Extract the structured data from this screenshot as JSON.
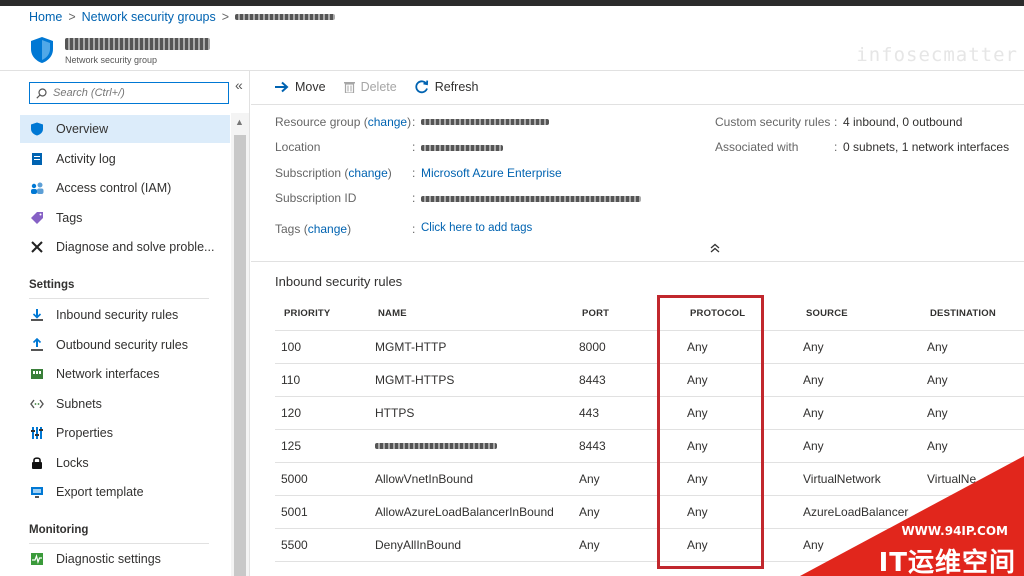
{
  "breadcrumb": {
    "home": "Home",
    "parent": "Network security groups",
    "sep": ">"
  },
  "resource": {
    "type_label": "Network security group"
  },
  "watermark": "infosecmatter",
  "sidebar": {
    "search_placeholder": "Search (Ctrl+/)",
    "collapse": "«",
    "items_top": [
      {
        "label": "Overview",
        "icon": "shield-icon"
      },
      {
        "label": "Activity log",
        "icon": "activity-log-icon"
      },
      {
        "label": "Access control (IAM)",
        "icon": "people-icon"
      },
      {
        "label": "Tags",
        "icon": "tag-icon"
      },
      {
        "label": "Diagnose and solve proble...",
        "icon": "wrench-icon"
      }
    ],
    "settings_title": "Settings",
    "items_settings": [
      {
        "label": "Inbound security rules",
        "icon": "inbound-icon"
      },
      {
        "label": "Outbound security rules",
        "icon": "outbound-icon"
      },
      {
        "label": "Network interfaces",
        "icon": "network-interface-icon"
      },
      {
        "label": "Subnets",
        "icon": "subnet-icon"
      },
      {
        "label": "Properties",
        "icon": "properties-icon"
      },
      {
        "label": "Locks",
        "icon": "lock-icon"
      },
      {
        "label": "Export template",
        "icon": "export-icon"
      }
    ],
    "monitoring_title": "Monitoring",
    "items_monitoring": [
      {
        "label": "Diagnostic settings",
        "icon": "diagnostic-icon"
      }
    ]
  },
  "toolbar": {
    "move": "Move",
    "delete": "Delete",
    "refresh": "Refresh"
  },
  "essentials": {
    "resource_group_label": "Resource group",
    "change": "change",
    "location_label": "Location",
    "subscription_label": "Subscription",
    "subscription_value": "Microsoft Azure Enterprise",
    "subscription_id_label": "Subscription ID",
    "tags_label": "Tags",
    "tags_value": "Click here to add tags",
    "custom_rules_label": "Custom security rules",
    "custom_rules_value": "4 inbound, 0 outbound",
    "associated_label": "Associated with",
    "associated_value": "0 subnets, 1 network interfaces",
    "colon": ":"
  },
  "rules": {
    "title": "Inbound security rules",
    "columns": [
      "PRIORITY",
      "NAME",
      "PORT",
      "PROTOCOL",
      "SOURCE",
      "DESTINATION"
    ],
    "rows": [
      [
        "100",
        "MGMT-HTTP",
        "8000",
        "Any",
        "Any",
        "Any"
      ],
      [
        "110",
        "MGMT-HTTPS",
        "8443",
        "Any",
        "Any",
        "Any"
      ],
      [
        "120",
        "HTTPS",
        "443",
        "Any",
        "Any",
        "Any"
      ],
      [
        "125",
        "",
        "8443",
        "Any",
        "Any",
        "Any"
      ],
      [
        "5000",
        "AllowVnetInBound",
        "Any",
        "Any",
        "VirtualNetwork",
        "VirtualNe"
      ],
      [
        "5001",
        "AllowAzureLoadBalancerInBound",
        "Any",
        "Any",
        "AzureLoadBalancer",
        ""
      ],
      [
        "5500",
        "DenyAllInBound",
        "Any",
        "Any",
        "Any",
        ""
      ]
    ]
  },
  "corner": {
    "url": "WWW.94IP.COM",
    "brand": "IT运维空间"
  },
  "colors": {
    "accent": "#0078d4",
    "link": "#0063b1",
    "highlight": "#c1272d",
    "corner": "#e1261c"
  }
}
